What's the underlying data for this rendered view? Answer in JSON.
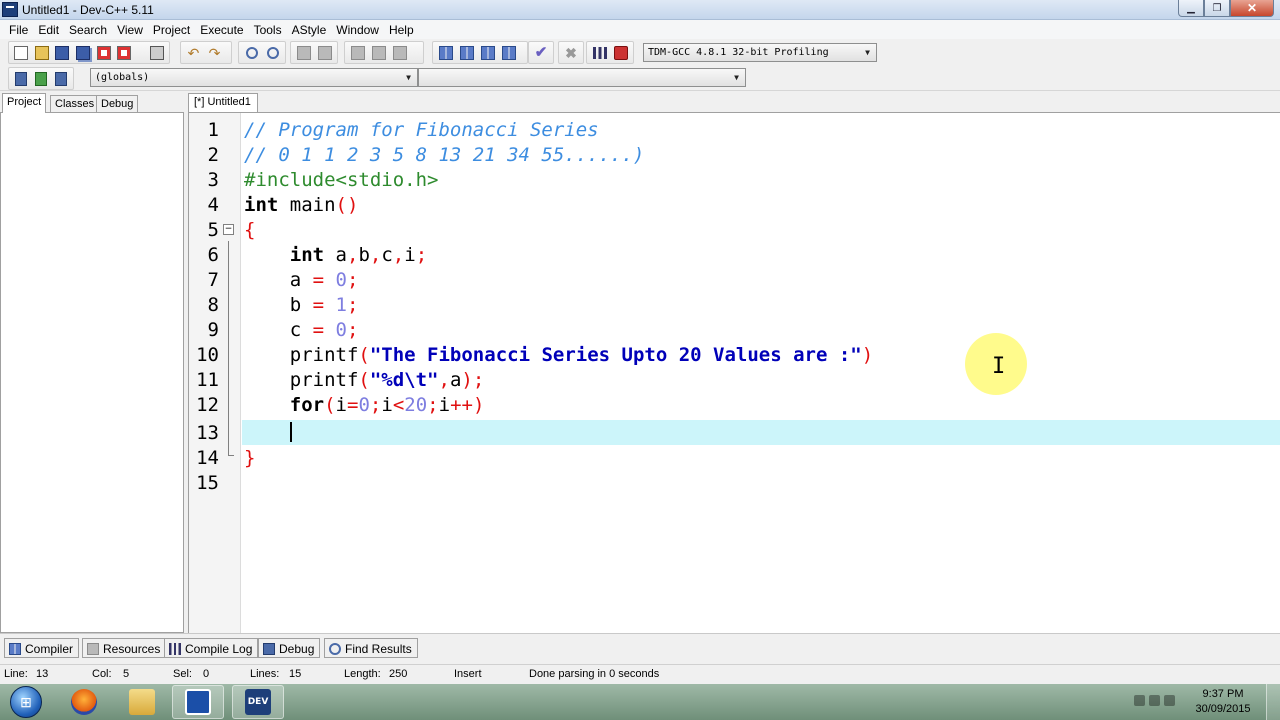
{
  "window": {
    "title": "Untitled1 - Dev-C++ 5.11"
  },
  "menu": [
    "File",
    "Edit",
    "Search",
    "View",
    "Project",
    "Execute",
    "Tools",
    "AStyle",
    "Window",
    "Help"
  ],
  "toolbar": {
    "compiler_select": "TDM-GCC 4.8.1 32-bit Profiling",
    "scope_select": "(globals)",
    "symbol_select": ""
  },
  "left_tabs": [
    "Project",
    "Classes",
    "Debug"
  ],
  "editor": {
    "tab_label": "[*] Untitled1",
    "current_line": 13,
    "lines": [
      {
        "n": "1"
      },
      {
        "n": "2"
      },
      {
        "n": "3"
      },
      {
        "n": "4"
      },
      {
        "n": "5"
      },
      {
        "n": "6"
      },
      {
        "n": "7"
      },
      {
        "n": "8"
      },
      {
        "n": "9"
      },
      {
        "n": "10"
      },
      {
        "n": "11"
      },
      {
        "n": "12"
      },
      {
        "n": "13"
      },
      {
        "n": "14"
      },
      {
        "n": "15"
      }
    ],
    "code": {
      "l1": "// Program for Fibonacci Series",
      "l2": "// 0 1 1 2 3 5 8 13 21 34 55......)",
      "l3": "#include<stdio.h>",
      "l4_kw": "int",
      "l4_id": " main",
      "l4_sym": "()",
      "l5": "{",
      "l6_kw": "int",
      "l6_a": " a",
      "l6_c1": ",",
      "l6_b": "b",
      "l6_c2": ",",
      "l6_c": "c",
      "l6_c3": ",",
      "l6_i": "i",
      "l6_s": ";",
      "l7_id": "a ",
      "l7_eq": "=",
      "l7_num": " 0",
      "l7_s": ";",
      "l8_id": "b ",
      "l8_eq": "=",
      "l8_num": " 1",
      "l8_s": ";",
      "l9_id": "c ",
      "l9_eq": "=",
      "l9_num": " 0",
      "l9_s": ";",
      "l10_id": "printf",
      "l10_p1": "(",
      "l10_str": "\"The Fibonacci Series Upto 20 Values are :\"",
      "l10_p2": ")",
      "l11_id": "printf",
      "l11_p1": "(",
      "l11_str": "\"%d\\t\"",
      "l11_c": ",",
      "l11_a": "a",
      "l11_p2": ");",
      "l12_kw": "for",
      "l12_p1": "(",
      "l12_i1": "i",
      "l12_eq": "=",
      "l12_n0": "0",
      "l12_s1": ";",
      "l12_i2": "i",
      "l12_lt": "<",
      "l12_n20": "20",
      "l12_s2": ";",
      "l12_i3": "i",
      "l12_pp": "++)",
      "l14": "}"
    }
  },
  "bottom_tabs": [
    "Compiler",
    "Resources",
    "Compile Log",
    "Debug",
    "Find Results"
  ],
  "status": {
    "line_label": "Line:",
    "line_value": "13",
    "col_label": "Col:",
    "col_value": "5",
    "sel_label": "Sel:",
    "sel_value": "0",
    "lines_label": "Lines:",
    "lines_value": "15",
    "length_label": "Length:",
    "length_value": "250",
    "mode": "Insert",
    "message": "Done parsing in 0 seconds"
  },
  "taskbar": {
    "time": "9:37 PM",
    "date": "30/09/2015",
    "apps": [
      "firefox-icon",
      "file-explorer-icon",
      "remote-app-icon",
      "devcpp-icon"
    ]
  },
  "colors": {
    "comment": "#3d8de0",
    "symbol": "#e01010",
    "number": "#7e7ee0",
    "string": "#0000b8",
    "current_line": "#ccf5fa",
    "preprocessor": "#2e8b2e"
  }
}
